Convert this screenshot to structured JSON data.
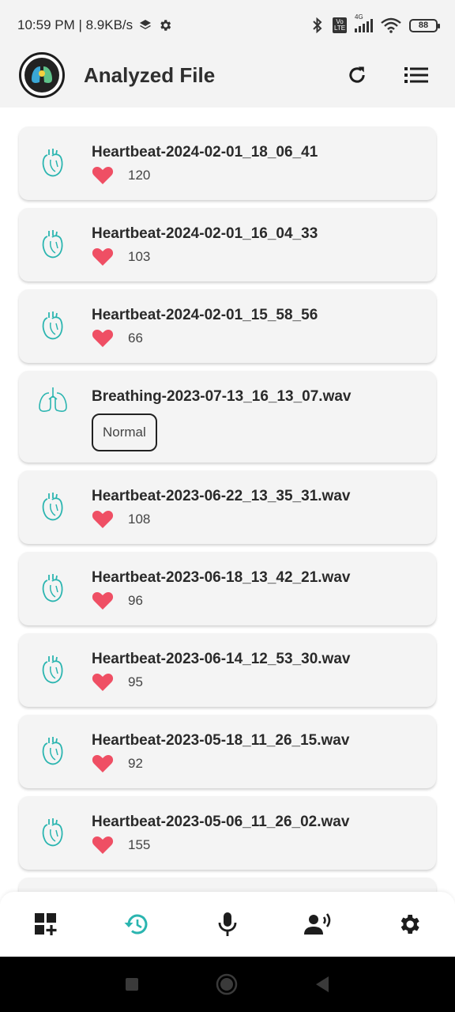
{
  "status": {
    "time_speed": "10:59 PM | 8.9KB/s",
    "battery": "88",
    "network": "4G",
    "volte": "Vo LTE"
  },
  "app": {
    "title": "Analyzed File"
  },
  "items": [
    {
      "type": "heartbeat",
      "title": "Heartbeat-2024-02-01_18_06_41",
      "bpm": "120"
    },
    {
      "type": "heartbeat",
      "title": "Heartbeat-2024-02-01_16_04_33",
      "bpm": "103"
    },
    {
      "type": "heartbeat",
      "title": "Heartbeat-2024-02-01_15_58_56",
      "bpm": "66"
    },
    {
      "type": "breathing",
      "title": "Breathing-2023-07-13_16_13_07.wav",
      "result": "Normal"
    },
    {
      "type": "heartbeat",
      "title": "Heartbeat-2023-06-22_13_35_31.wav",
      "bpm": "108"
    },
    {
      "type": "heartbeat",
      "title": "Heartbeat-2023-06-18_13_42_21.wav",
      "bpm": "96"
    },
    {
      "type": "heartbeat",
      "title": "Heartbeat-2023-06-14_12_53_30.wav",
      "bpm": "95"
    },
    {
      "type": "heartbeat",
      "title": "Heartbeat-2023-05-18_11_26_15.wav",
      "bpm": "92"
    },
    {
      "type": "heartbeat",
      "title": "Heartbeat-2023-05-06_11_26_02.wav",
      "bpm": "155"
    }
  ],
  "nav": {
    "active": "history",
    "items": [
      "dashboard-add-icon",
      "history-icon",
      "microphone-icon",
      "voice-user-icon",
      "settings-icon"
    ]
  },
  "colors": {
    "accent": "#2bb5b0",
    "heart": "#ef4f64",
    "card_bg": "#f4f4f4",
    "bar_bg": "#f3f3f3"
  }
}
